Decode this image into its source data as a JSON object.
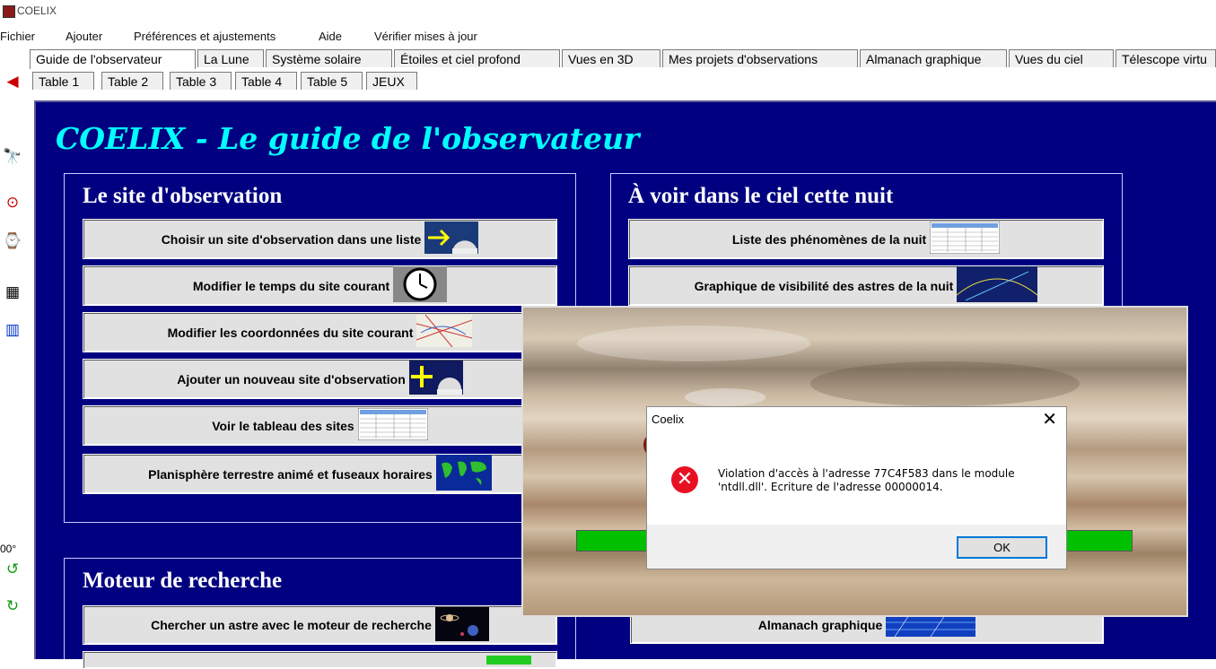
{
  "window": {
    "title": "COELIX"
  },
  "menu": [
    "Fichier",
    "Ajouter",
    "Préférences et ajustements",
    "Aide",
    "Vérifier mises à jour"
  ],
  "tabs_top": [
    "Guide de l'observateur",
    "La Lune",
    "Système solaire",
    "Étoiles et ciel profond",
    "Vues en 3D",
    "Mes projets d'observations",
    "Almanach graphique",
    "Vues du ciel",
    "Télescope virtu"
  ],
  "tabs_bottom": [
    "Table 1",
    "Table 2",
    "Table 3",
    "Table 4",
    "Table 5",
    "JEUX"
  ],
  "left_toolbar": {
    "rotation_label": "00°"
  },
  "main": {
    "title": "COELIX  -  Le guide de l'observateur",
    "site_group": {
      "title": "Le site d'observation",
      "buttons": [
        "Choisir un site d'observation dans une liste",
        "Modifier le temps du site courant",
        "Modifier les coordonnées du site courant",
        "Ajouter un nouveau site d'observation",
        "Voir le tableau des sites",
        "Planisphère terrestre animé et fuseaux horaires"
      ]
    },
    "sky_group": {
      "title": "À voir dans le ciel cette nuit",
      "buttons": [
        "Liste des phénomènes de la nuit",
        "Graphique de visibilité des astres de la nuit"
      ]
    },
    "search_group": {
      "title": "Moteur de recherche",
      "buttons": [
        "Chercher un astre avec le moteur de recherche"
      ]
    },
    "almanach_button": "Almanach graphique"
  },
  "dialog": {
    "title": "Coelix",
    "message": "Violation d'accès à l'adresse 77C4F583 dans le module 'ntdll.dll'. Ecriture de l'adresse 00000014.",
    "ok_label": "OK",
    "close_glyph": "✕",
    "error_glyph": "✕"
  },
  "colors": {
    "main_bg": "#000080",
    "title_cyan": "#00ffff",
    "progress_green": "#00c000",
    "error_red": "#e81123",
    "focus_blue": "#0078d7"
  }
}
